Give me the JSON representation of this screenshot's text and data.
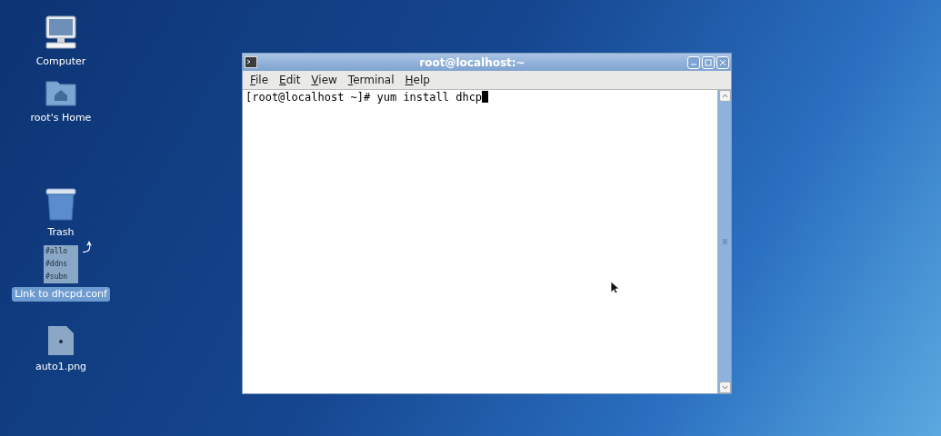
{
  "desktop_icons": [
    {
      "kind": "computer",
      "label": "Computer",
      "selected": false
    },
    {
      "kind": "home",
      "label": "root's Home",
      "selected": false
    },
    {
      "kind": "trash",
      "label": "Trash",
      "selected": false
    },
    {
      "kind": "link",
      "label": "Link to dhcpd.conf",
      "selected": true,
      "thumbnail_lines": [
        "#allo",
        "#ddns",
        "#subn"
      ]
    },
    {
      "kind": "image",
      "label": "auto1.png",
      "selected": false
    }
  ],
  "window": {
    "title": "root@localhost:~",
    "menu": [
      "File",
      "Edit",
      "View",
      "Terminal",
      "Help"
    ],
    "terminal": {
      "prompt": "[root@localhost ~]# ",
      "command": "yum install dhcp"
    }
  }
}
